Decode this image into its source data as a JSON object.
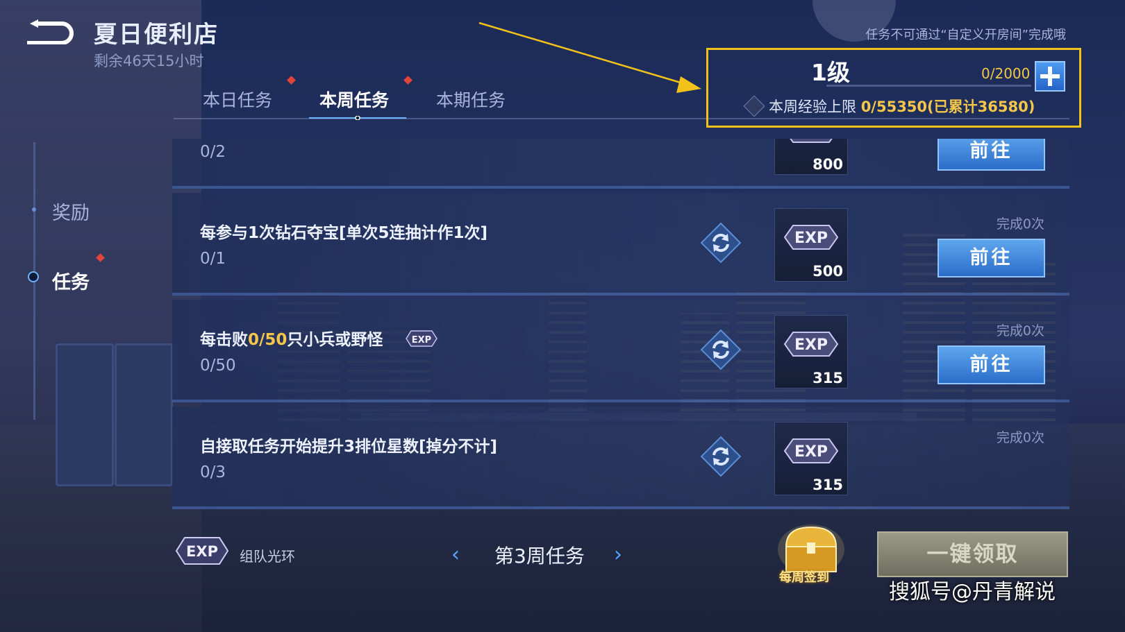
{
  "header": {
    "title": "夏日便利店",
    "time_remaining": "剩余46天15小时",
    "notice": "任务不可通过“自定义开房间”完成哦"
  },
  "tabs": [
    {
      "label": "本日任务",
      "has_alert": true
    },
    {
      "label": "本周任务",
      "has_alert": true,
      "active": true
    },
    {
      "label": "本期任务"
    }
  ],
  "side_nav": [
    {
      "label": "奖励"
    },
    {
      "label": "任务",
      "has_alert": true,
      "active": true
    }
  ],
  "level_panel": {
    "level": "1级",
    "progress": "0/2000",
    "exp_limit_prefix": "本周经验上限",
    "exp_limit_value": "0/55350",
    "exp_accumulated": "(已累计36580)"
  },
  "tasks": [
    {
      "name": "",
      "progress": "0/2",
      "exp": "800",
      "done": "",
      "button": "前往"
    },
    {
      "name": "每参与1次钻石夺宝[单次5连抽计作1次]",
      "progress": "0/1",
      "exp": "500",
      "done": "完成0次",
      "button": "前往"
    },
    {
      "name_parts": [
        "每击败",
        "0/50",
        "只小兵或野怪"
      ],
      "progress": "0/50",
      "exp": "315",
      "done": "完成0次",
      "button": "前往"
    },
    {
      "name": "自接取任务开始提升3排位星数[掉分不计]",
      "progress": "0/3",
      "exp": "315",
      "done": "完成0次"
    }
  ],
  "footer": {
    "team_aura_label": "组队光环",
    "week_label": "第3周任务",
    "prev_arrow": "‹",
    "next_arrow": "›",
    "weekly_checkin_label": "每周签到",
    "claim_all_label": "一键领取"
  },
  "exp_icon_text": "EXP",
  "watermark": "搜狐号@丹青解说",
  "colors": {
    "highlight": "#f5c64a",
    "annotation": "#f2c21b",
    "button_blue": "#2a6dc9"
  }
}
